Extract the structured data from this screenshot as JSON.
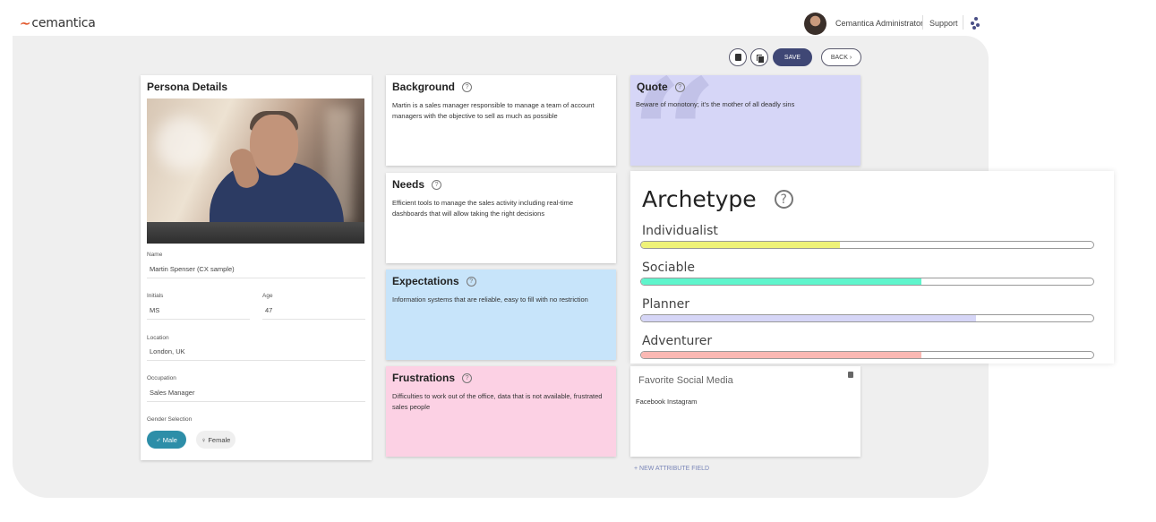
{
  "header": {
    "logo": "cemantica",
    "user": "Cemantica Administrator",
    "support": "Support",
    "icons": [
      "avatar",
      "org-icon"
    ]
  },
  "toolbar": {
    "delete_icon": "trash-icon",
    "copy_icon": "copy-icon",
    "save_label": "SAVE",
    "back_label": "BACK ›"
  },
  "persona": {
    "title": "Persona Details",
    "name_label": "Name",
    "name_value": "Martin Spenser (CX sample)",
    "initials_label": "Initials",
    "initials_value": "MS",
    "age_label": "Age",
    "age_value": "47",
    "location_label": "Location",
    "location_value": "London, UK",
    "occupation_label": "Occupation",
    "occupation_value": "Sales Manager",
    "gender_label": "Gender Selection",
    "gender_male": "♂ Male",
    "gender_female": "♀ Female",
    "gender_selected": "Male"
  },
  "cards": {
    "background": {
      "title": "Background",
      "text": "Martin is a sales manager responsible to manage a team of account managers with the objective to sell as much as possible"
    },
    "needs": {
      "title": "Needs",
      "text": "Efficient tools to manage the sales activity including real-time dashboards that will allow taking the right decisions"
    },
    "expectations": {
      "title": "Expectations",
      "text": "Information systems that are reliable, easy to fill with no restriction"
    },
    "frustrations": {
      "title": "Frustrations",
      "text": "Difficulties to work out of the office, data that is not available, frustrated sales people"
    },
    "quote": {
      "title": "Quote",
      "text": "Beware of monotony; it's the mother of all deadly sins",
      "glyph": "“"
    },
    "social": {
      "title": "Favorite Social Media",
      "text": "Facebook Instagram"
    }
  },
  "archetype": {
    "title": "Archetype",
    "items": [
      {
        "label": "Individualist",
        "value": 0.44,
        "color": "#eef278"
      },
      {
        "label": "Sociable",
        "value": 0.62,
        "color": "#5ff5cc"
      },
      {
        "label": "Planner",
        "value": 0.74,
        "color": "#d6d6f7"
      },
      {
        "label": "Adventurer",
        "value": 0.62,
        "color": "#fab8b3"
      }
    ]
  },
  "footer": {
    "new_attribute": "+ NEW ATTRIBUTE FIELD"
  }
}
